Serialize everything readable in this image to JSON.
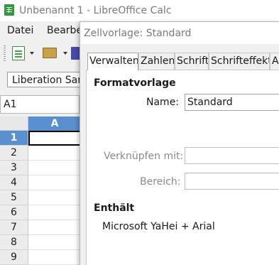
{
  "window": {
    "title": "Unbenannt 1 - LibreOffice Calc"
  },
  "menu": {
    "items": [
      "Datei",
      "Bearbeiten"
    ]
  },
  "toolbar": {
    "font_name": "Liberation Sans"
  },
  "namebox": {
    "value": "A1"
  },
  "sheet": {
    "columns": [
      "A"
    ],
    "rows": [
      "1",
      "2",
      "3",
      "4",
      "5",
      "6",
      "7",
      "8",
      "9"
    ],
    "selected_row": "1"
  },
  "dialog": {
    "title": "Zellvorlage: Standard",
    "tabs": [
      "Verwalten",
      "Zahlen",
      "Schrift",
      "Schrifteffekt",
      "A"
    ],
    "selected_tab": "Verwalten",
    "section_style": "Formatvorlage",
    "name_label": "Name:",
    "name_value": "Standard",
    "link_label": "Verknüpfen mit:",
    "category_label": "Bereich:",
    "section_contains": "Enthält",
    "contains_text": "Microsoft YaHei + Arial"
  },
  "colors": {
    "selection": "#5a8fcf",
    "calc_green": "#2e9a3a"
  }
}
